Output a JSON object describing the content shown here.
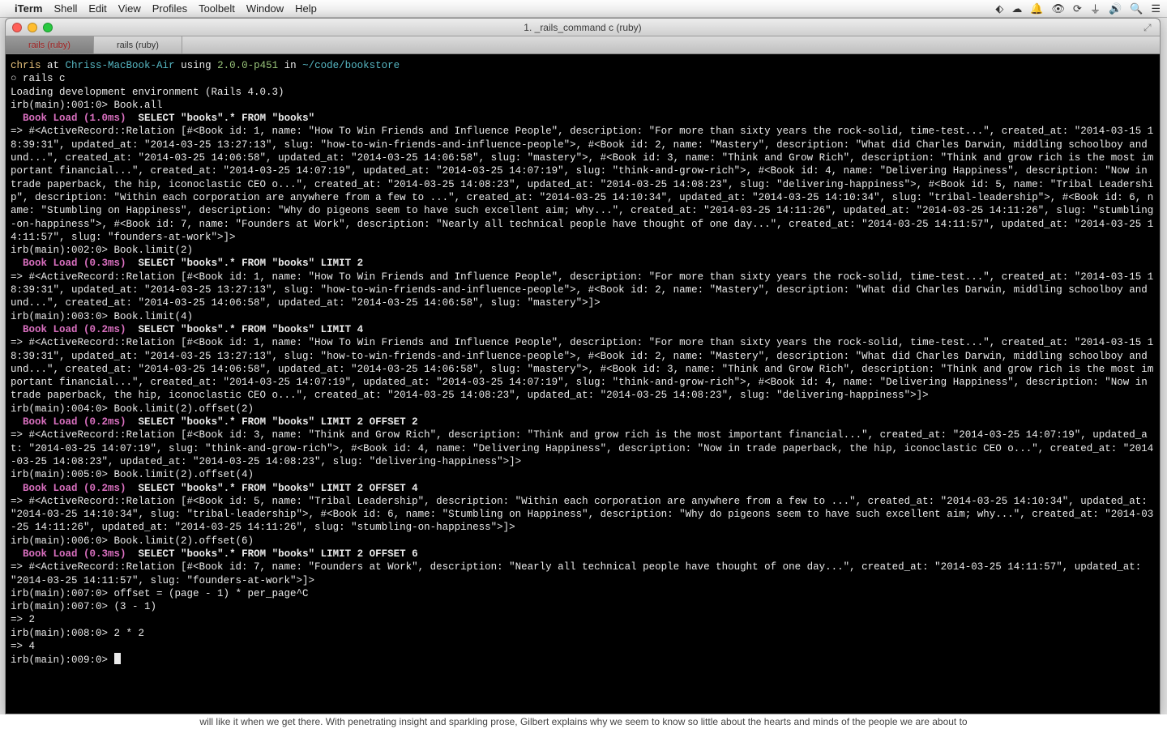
{
  "menubar": {
    "apple": "",
    "app": "iTerm",
    "items": [
      "Shell",
      "Edit",
      "View",
      "Profiles",
      "Toolbelt",
      "Window",
      "Help"
    ],
    "right_icons": [
      "dropbox-icon",
      "cloud-icon",
      "bell-icon",
      "eye-icon",
      "sync-icon",
      "wifi-icon",
      "volume-icon",
      "search-icon",
      "menu-icon"
    ]
  },
  "window": {
    "title": "1. _rails_command c (ruby)",
    "tabs": [
      {
        "label": "rails (ruby)",
        "active": true
      },
      {
        "label": "rails (ruby)",
        "active": false
      }
    ]
  },
  "prompt": {
    "user": "chris",
    "at": " at ",
    "host": "Chriss-MacBook-Air",
    "using": " using ",
    "ruby": "2.0.0-p451",
    "in": " in ",
    "path": "~/code/bookstore"
  },
  "lines": {
    "l1": "○ rails c",
    "l2": "Loading development environment (Rails 4.0.3)",
    "l3": "irb(main):001:0> Book.all",
    "l4a": "  Book Load (1.0ms)",
    "l4b": "  SELECT \"books\".* FROM \"books\"",
    "l5": "=> #<ActiveRecord::Relation [#<Book id: 1, name: \"How To Win Friends and Influence People\", description: \"For more than sixty years the rock-solid, time-test...\", created_at: \"2014-03-15 18:39:31\", updated_at: \"2014-03-25 13:27:13\", slug: \"how-to-win-friends-and-influence-people\">, #<Book id: 2, name: \"Mastery\", description: \"What did Charles Darwin, middling schoolboy and und...\", created_at: \"2014-03-25 14:06:58\", updated_at: \"2014-03-25 14:06:58\", slug: \"mastery\">, #<Book id: 3, name: \"Think and Grow Rich\", description: \"Think and grow rich is the most important financial...\", created_at: \"2014-03-25 14:07:19\", updated_at: \"2014-03-25 14:07:19\", slug: \"think-and-grow-rich\">, #<Book id: 4, name: \"Delivering Happiness\", description: \"Now in trade paperback, the hip, iconoclastic CEO o...\", created_at: \"2014-03-25 14:08:23\", updated_at: \"2014-03-25 14:08:23\", slug: \"delivering-happiness\">, #<Book id: 5, name: \"Tribal Leadership\", description: \"Within each corporation are anywhere from a few to ...\", created_at: \"2014-03-25 14:10:34\", updated_at: \"2014-03-25 14:10:34\", slug: \"tribal-leadership\">, #<Book id: 6, name: \"Stumbling on Happiness\", description: \"Why do pigeons seem to have such excellent aim; why...\", created_at: \"2014-03-25 14:11:26\", updated_at: \"2014-03-25 14:11:26\", slug: \"stumbling-on-happiness\">, #<Book id: 7, name: \"Founders at Work\", description: \"Nearly all technical people have thought of one day...\", created_at: \"2014-03-25 14:11:57\", updated_at: \"2014-03-25 14:11:57\", slug: \"founders-at-work\">]>",
    "l6": "irb(main):002:0> Book.limit(2)",
    "l7a": "  Book Load (0.3ms)",
    "l7b": "  SELECT \"books\".* FROM \"books\" LIMIT 2",
    "l8": "=> #<ActiveRecord::Relation [#<Book id: 1, name: \"How To Win Friends and Influence People\", description: \"For more than sixty years the rock-solid, time-test...\", created_at: \"2014-03-15 18:39:31\", updated_at: \"2014-03-25 13:27:13\", slug: \"how-to-win-friends-and-influence-people\">, #<Book id: 2, name: \"Mastery\", description: \"What did Charles Darwin, middling schoolboy and und...\", created_at: \"2014-03-25 14:06:58\", updated_at: \"2014-03-25 14:06:58\", slug: \"mastery\">]>",
    "l9": "irb(main):003:0> Book.limit(4)",
    "l10a": "  Book Load (0.2ms)",
    "l10b": "  SELECT \"books\".* FROM \"books\" LIMIT 4",
    "l11": "=> #<ActiveRecord::Relation [#<Book id: 1, name: \"How To Win Friends and Influence People\", description: \"For more than sixty years the rock-solid, time-test...\", created_at: \"2014-03-15 18:39:31\", updated_at: \"2014-03-25 13:27:13\", slug: \"how-to-win-friends-and-influence-people\">, #<Book id: 2, name: \"Mastery\", description: \"What did Charles Darwin, middling schoolboy and und...\", created_at: \"2014-03-25 14:06:58\", updated_at: \"2014-03-25 14:06:58\", slug: \"mastery\">, #<Book id: 3, name: \"Think and Grow Rich\", description: \"Think and grow rich is the most important financial...\", created_at: \"2014-03-25 14:07:19\", updated_at: \"2014-03-25 14:07:19\", slug: \"think-and-grow-rich\">, #<Book id: 4, name: \"Delivering Happiness\", description: \"Now in trade paperback, the hip, iconoclastic CEO o...\", created_at: \"2014-03-25 14:08:23\", updated_at: \"2014-03-25 14:08:23\", slug: \"delivering-happiness\">]>",
    "l12": "irb(main):004:0> Book.limit(2).offset(2)",
    "l13a": "  Book Load (0.2ms)",
    "l13b": "  SELECT \"books\".* FROM \"books\" LIMIT 2 OFFSET 2",
    "l14": "=> #<ActiveRecord::Relation [#<Book id: 3, name: \"Think and Grow Rich\", description: \"Think and grow rich is the most important financial...\", created_at: \"2014-03-25 14:07:19\", updated_at: \"2014-03-25 14:07:19\", slug: \"think-and-grow-rich\">, #<Book id: 4, name: \"Delivering Happiness\", description: \"Now in trade paperback, the hip, iconoclastic CEO o...\", created_at: \"2014-03-25 14:08:23\", updated_at: \"2014-03-25 14:08:23\", slug: \"delivering-happiness\">]>",
    "l15": "irb(main):005:0> Book.limit(2).offset(4)",
    "l16a": "  Book Load (0.2ms)",
    "l16b": "  SELECT \"books\".* FROM \"books\" LIMIT 2 OFFSET 4",
    "l17": "=> #<ActiveRecord::Relation [#<Book id: 5, name: \"Tribal Leadership\", description: \"Within each corporation are anywhere from a few to ...\", created_at: \"2014-03-25 14:10:34\", updated_at: \"2014-03-25 14:10:34\", slug: \"tribal-leadership\">, #<Book id: 6, name: \"Stumbling on Happiness\", description: \"Why do pigeons seem to have such excellent aim; why...\", created_at: \"2014-03-25 14:11:26\", updated_at: \"2014-03-25 14:11:26\", slug: \"stumbling-on-happiness\">]>",
    "l18": "irb(main):006:0> Book.limit(2).offset(6)",
    "l19a": "  Book Load (0.3ms)",
    "l19b": "  SELECT \"books\".* FROM \"books\" LIMIT 2 OFFSET 6",
    "l20": "=> #<ActiveRecord::Relation [#<Book id: 7, name: \"Founders at Work\", description: \"Nearly all technical people have thought of one day...\", created_at: \"2014-03-25 14:11:57\", updated_at: \"2014-03-25 14:11:57\", slug: \"founders-at-work\">]>",
    "l21": "irb(main):007:0> offset = (page - 1) * per_page^C",
    "l22": "irb(main):007:0> (3 - 1)",
    "l23": "=> 2",
    "l24": "irb(main):008:0> 2 * 2",
    "l25": "=> 4",
    "l26": "irb(main):009:0> "
  },
  "peek": "will like it when we get there. With penetrating insight and sparkling prose, Gilbert explains why we seem to know so little about the hearts and minds of the people we are about to"
}
